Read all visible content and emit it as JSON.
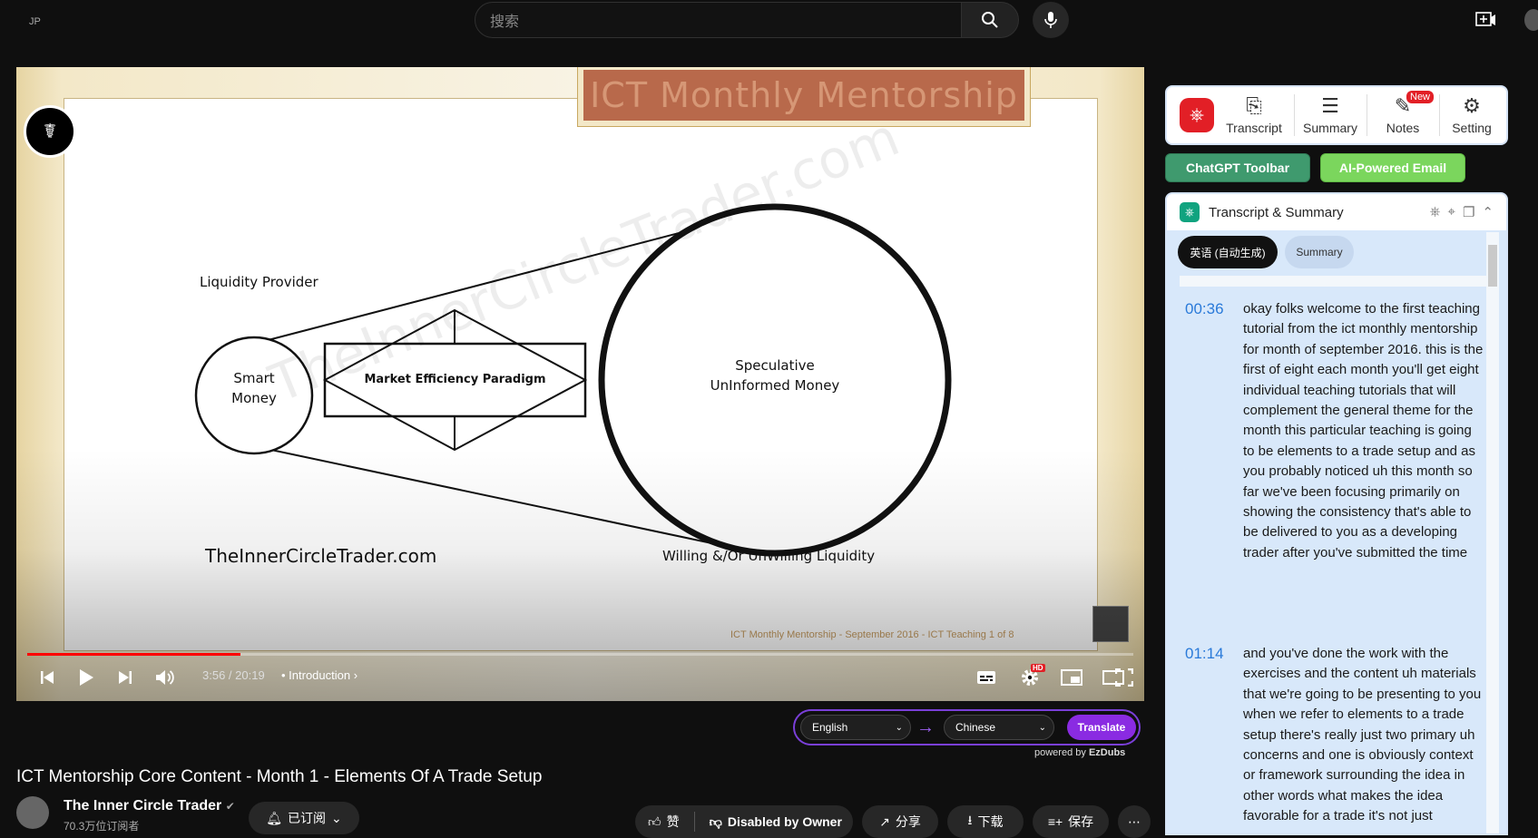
{
  "topbar": {
    "region_label": "JP",
    "search_placeholder": "搜索",
    "search_icon": "search-icon",
    "mic_icon": "microphone-icon",
    "create_icon": "create-video-icon"
  },
  "video": {
    "banner_title": "ICT Monthly Mentorship",
    "diagram": {
      "liquidity_provider": "Liquidity Provider",
      "smart_money_line1": "Smart",
      "smart_money_line2": "Money",
      "paradigm": "Market Efficiency Paradigm",
      "speculative_line1": "Speculative",
      "speculative_line2": "UnInformed Money",
      "site": "TheInnerCircleTrader.com",
      "willing": "Willing &/Or UnWilling Liquidity",
      "watermark": "TheInnerCircleTrader.com",
      "footer_credit": "ICT Monthly Mentorship - September 2016 - ICT Teaching 1 of 8"
    },
    "controls": {
      "time": "3:56 / 20:19",
      "chapter": "• Introduction ›",
      "progress_fraction": 0.193,
      "settings_badge": "HD"
    }
  },
  "translate": {
    "source_lang": "English",
    "target_lang": "Chinese",
    "button": "Translate",
    "powered_prefix": "powered by ",
    "powered_brand": "EzDubs"
  },
  "meta": {
    "title": "ICT Mentorship Core Content - Month 1 - Elements Of A Trade Setup",
    "channel_name": "The Inner Circle Trader",
    "subscribers": "70.3万位订阅者",
    "subscribed_label": "已订阅",
    "like_label": "赞",
    "dislike_label": "Disabled by Owner",
    "share_label": "分享",
    "download_label": "下载",
    "save_label": "保存",
    "more_label": "⋯"
  },
  "extension": {
    "toolbar_items": [
      "Transcript",
      "Summary",
      "Notes",
      "Setting"
    ],
    "new_badge": "New",
    "chatgpt_toolbar": "ChatGPT Toolbar",
    "ai_email": "AI-Powered Email",
    "panel_title": "Transcript & Summary",
    "tab_transcript": "英语 (自动生成)",
    "tab_summary": "Summary",
    "entries": [
      {
        "time": "00:36",
        "text": "okay folks welcome to the first teaching tutorial from the ict monthly mentorship for month of september 2016. this is the first of eight each month you'll get eight individual teaching tutorials that will complement the general theme for the month this particular teaching is going to be elements to a trade setup and as you probably noticed uh this month so far we've been focusing primarily on showing the consistency that's able to be delivered to you as a developing trader after you've submitted the time"
      },
      {
        "time": "01:14",
        "text": "and you've done the work with the exercises and the content uh materials that we're going to be presenting to you when we refer to elements to a trade setup there's really just two primary uh concerns and one is obviously context or framework surrounding the idea in other words what makes the idea favorable for a trade it's not just"
      }
    ]
  },
  "colors": {
    "progress": "#ff0000",
    "translate_accent": "#8a2be2",
    "chatgpt_btn": "#3f9a6e",
    "email_btn": "#7bd65d",
    "timestamp": "#2a7ad9"
  }
}
